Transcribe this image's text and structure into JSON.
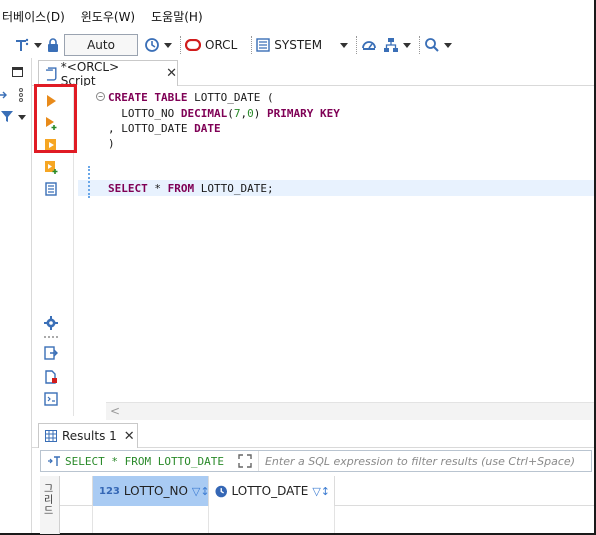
{
  "menu": {
    "items": [
      "터베이스(D)",
      "윈도우(W)",
      "도움말(H)"
    ]
  },
  "toolbar": {
    "commit_mode": "Auto",
    "datasource": "ORCL",
    "schema": "SYSTEM"
  },
  "editor": {
    "tab_label": "*<ORCL> Script",
    "code_lines": [
      {
        "parts": [
          [
            "kw",
            "CREATE TABLE"
          ],
          [
            "tx",
            " LOTTO_DATE ("
          ]
        ]
      },
      {
        "parts": [
          [
            "tx",
            "  LOTTO_NO "
          ],
          [
            "kw",
            "DECIMAL"
          ],
          [
            "tx",
            "("
          ],
          [
            "num",
            "7"
          ],
          [
            "tx",
            ","
          ],
          [
            "num",
            "0"
          ],
          [
            "tx",
            ") "
          ],
          [
            "kw",
            "PRIMARY KEY"
          ]
        ]
      },
      {
        "parts": [
          [
            "tx",
            ", LOTTO_DATE "
          ],
          [
            "kw",
            "DATE"
          ]
        ]
      },
      {
        "parts": [
          [
            "tx",
            ")"
          ]
        ]
      },
      {
        "parts": [
          [
            "kw",
            "SELECT"
          ],
          [
            "tx",
            " * "
          ],
          [
            "kw",
            "FROM"
          ],
          [
            "tx",
            " LOTTO_DATE;"
          ]
        ]
      }
    ],
    "scroll_left": "<"
  },
  "results": {
    "tab_label": "Results 1",
    "query": "SELECT * FROM LOTTO_DATE",
    "filter_placeholder": "Enter a SQL expression to filter results (use Ctrl+Space)",
    "side_tab": "그리드",
    "columns": [
      {
        "type": "123",
        "name": "LOTTO_NO"
      },
      {
        "type": "date",
        "name": "LOTTO_DATE"
      }
    ]
  },
  "colors": {
    "keyword": "#7f0055",
    "number": "#2a8a2a",
    "highlight_box": "#e01b24",
    "selected_column": "#a9cbf3"
  }
}
